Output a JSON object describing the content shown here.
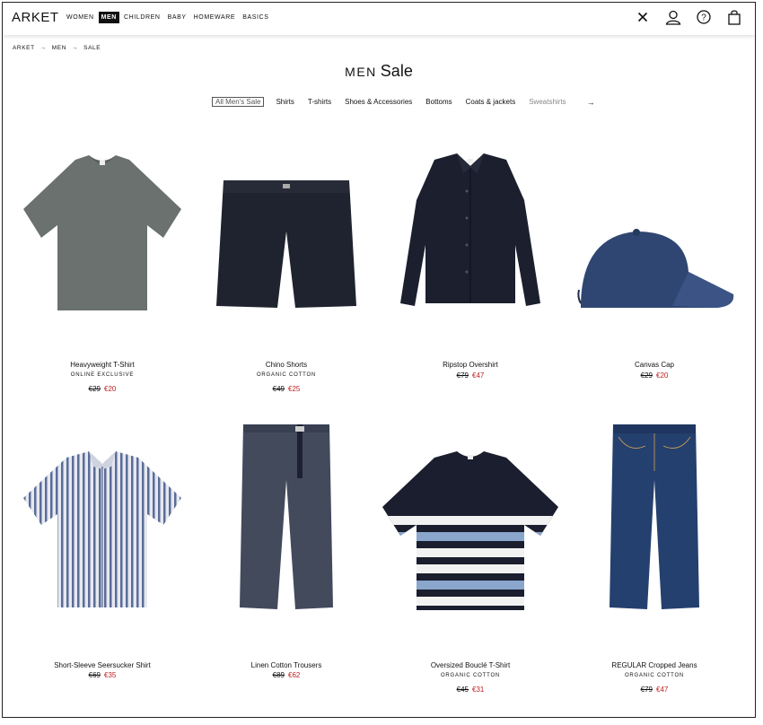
{
  "header": {
    "logo": "ARKET",
    "nav": [
      "WOMEN",
      "MEN",
      "CHILDREN",
      "BABY",
      "HOMEWARE",
      "BASICS"
    ],
    "active_nav": "MEN",
    "icons": [
      "close-icon",
      "account-icon",
      "help-icon",
      "bag-icon"
    ]
  },
  "breadcrumb": {
    "items": [
      "ARKET",
      "MEN",
      "SALE"
    ],
    "separator": "→"
  },
  "page": {
    "title_prefix": "MEN",
    "title": "Sale"
  },
  "filters": {
    "items": [
      "All Men's Sale",
      "Shirts",
      "T-shirts",
      "Shoes & Accessories",
      "Bottoms",
      "Coats & jackets",
      "Sweatshirts"
    ],
    "more_arrow": "→"
  },
  "products": [
    {
      "name": "Heavyweight T-Shirt",
      "tag": "ONLINE EXCLUSIVE",
      "old_price": "€29",
      "new_price": "€20",
      "image": "grey-tshirt"
    },
    {
      "name": "Chino Shorts",
      "tag": "ORGANIC COTTON",
      "old_price": "€49",
      "new_price": "€25",
      "image": "navy-shorts"
    },
    {
      "name": "Ripstop Overshirt",
      "tag": "",
      "old_price": "€79",
      "new_price": "€47",
      "image": "navy-overshirt"
    },
    {
      "name": "Canvas Cap",
      "tag": "",
      "old_price": "€29",
      "new_price": "€20",
      "image": "blue-cap"
    },
    {
      "name": "Short-Sleeve Seersucker Shirt",
      "tag": "",
      "old_price": "€69",
      "new_price": "€35",
      "image": "striped-shirt"
    },
    {
      "name": "Linen Cotton Trousers",
      "tag": "",
      "old_price": "€89",
      "new_price": "€62",
      "image": "grey-trousers"
    },
    {
      "name": "Oversized Bouclé T-Shirt",
      "tag": "ORGANIC COTTON",
      "old_price": "€45",
      "new_price": "€31",
      "image": "striped-tshirt"
    },
    {
      "name": "REGULAR Cropped Jeans",
      "tag": "ORGANIC COTTON",
      "old_price": "€79",
      "new_price": "€47",
      "image": "blue-jeans"
    }
  ],
  "colors": {
    "sale_red": "#c02020",
    "text": "#111111"
  }
}
